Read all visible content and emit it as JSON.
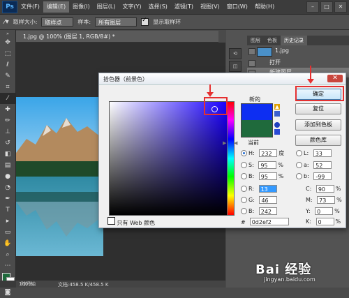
{
  "app": {
    "logo": "Ps"
  },
  "menu": [
    "文件(F)",
    "编辑(E)",
    "图像(I)",
    "图层(L)",
    "文字(Y)",
    "选择(S)",
    "滤镜(T)",
    "视图(V)",
    "窗口(W)",
    "帮助(H)"
  ],
  "menu_active_index": 1,
  "window_buttons": [
    "–",
    "□",
    "✕"
  ],
  "options_bar": {
    "sample_size_label": "取样大小:",
    "sample_size_value": "取样点",
    "sample_label": "样本:",
    "sample_value": "所有图层",
    "show_ring_label": "显示取样环"
  },
  "document": {
    "tab_title": "1.jpg @ 100% (图层 1, RGB/8#) *",
    "zoom": "100%",
    "doc_size": "文档:458.5 K/458.5 K",
    "timeline_label": "时间轴"
  },
  "panels": {
    "tabs": [
      "图层",
      "色板",
      "历史记录"
    ],
    "active_tab_index": 2,
    "history": {
      "snapshot": "1.jpg",
      "items": [
        "打开",
        "新建图层"
      ]
    }
  },
  "color_picker": {
    "title": "拾色器（前景色）",
    "new_label": "新的",
    "current_label": "当前",
    "new_color": "#0d2ef2",
    "current_color": "#1f6a3c",
    "buttons": {
      "ok": "确定",
      "reset": "复位",
      "add_swatch": "添加到色板",
      "libraries": "颜色库"
    },
    "hsb": {
      "h_label": "H:",
      "h_value": "232",
      "h_unit": "度",
      "s_label": "S:",
      "s_value": "95",
      "s_unit": "%",
      "b_label": "B:",
      "b_value": "95",
      "b_unit": "%"
    },
    "rgb": {
      "r_label": "R:",
      "r_value": "13",
      "g_label": "G:",
      "g_value": "46",
      "b_label": "B:",
      "b_value": "242"
    },
    "lab": {
      "l_label": "L:",
      "l_value": "33",
      "a_label": "a:",
      "a_value": "52",
      "b_label": "b:",
      "b_value": "-99"
    },
    "cmyk": {
      "c_label": "C:",
      "c_value": "90",
      "c_unit": "%",
      "m_label": "M:",
      "m_value": "73",
      "m_unit": "%",
      "y_label": "Y:",
      "y_value": "0",
      "y_unit": "%",
      "k_label": "K:",
      "k_value": "0",
      "k_unit": "%"
    },
    "web_only_label": "只有 Web 颜色",
    "hex_label": "#",
    "hex_value": "0d2ef2"
  },
  "watermark": {
    "main": "Bai 经验",
    "sub": "jingyan.baidu.com"
  }
}
